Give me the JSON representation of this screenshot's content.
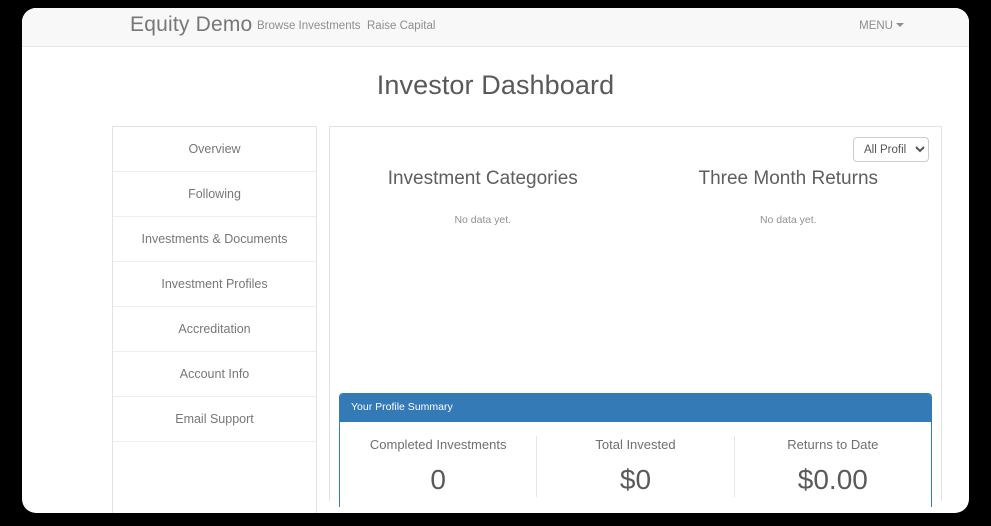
{
  "navbar": {
    "brand": "Equity Demo",
    "links": [
      {
        "label": "Browse Investments"
      },
      {
        "label": "Raise Capital"
      }
    ],
    "menu_label": "MENU"
  },
  "page": {
    "title": "Investor Dashboard"
  },
  "sidebar": {
    "items": [
      {
        "label": "Overview"
      },
      {
        "label": "Following"
      },
      {
        "label": "Investments & Documents"
      },
      {
        "label": "Investment Profiles"
      },
      {
        "label": "Accreditation"
      },
      {
        "label": "Account Info"
      },
      {
        "label": "Email Support"
      }
    ]
  },
  "filter": {
    "selected": "All Profiles",
    "options": [
      "All Profiles"
    ]
  },
  "charts": [
    {
      "title": "Investment Categories",
      "empty_text": "No data yet."
    },
    {
      "title": "Three Month Returns",
      "empty_text": "No data yet."
    }
  ],
  "chart_data": [
    {
      "type": "pie",
      "title": "Investment Categories",
      "categories": [],
      "values": [],
      "empty": true,
      "empty_text": "No data yet.",
      "legend": "none",
      "grid": false
    },
    {
      "type": "line",
      "title": "Three Month Returns",
      "x": [],
      "series": [],
      "empty": true,
      "empty_text": "No data yet.",
      "xlabel": "",
      "ylabel": "",
      "legend": "none",
      "grid": false
    }
  ],
  "summary": {
    "heading": "Your Profile Summary",
    "accent_color": "#337ab7",
    "stats": [
      {
        "label": "Completed Investments",
        "value": "0"
      },
      {
        "label": "Total Invested",
        "value": "$0"
      },
      {
        "label": "Returns to Date",
        "value": "$0.00"
      }
    ]
  }
}
